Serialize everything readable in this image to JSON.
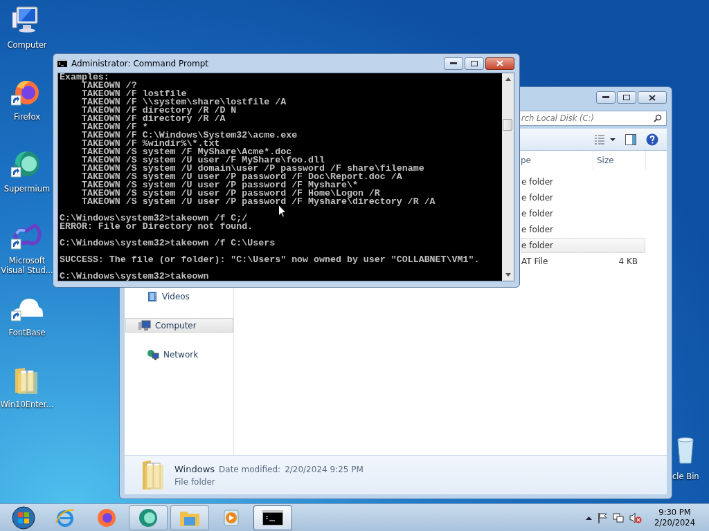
{
  "desktop_icons": [
    {
      "label": "Computer",
      "kind": "computer",
      "shortcut": false
    },
    {
      "label": "Firefox",
      "kind": "firefox",
      "shortcut": true
    },
    {
      "label": "Supermium",
      "kind": "supermium",
      "shortcut": true
    },
    {
      "label": "Microsoft Visual Stud...",
      "kind": "vs",
      "shortcut": true
    },
    {
      "label": "FontBase",
      "kind": "fontbase",
      "shortcut": true
    },
    {
      "label": "Win10Enter...",
      "kind": "folder",
      "shortcut": false
    }
  ],
  "recycle_bin": {
    "label": "cle Bin"
  },
  "explorer": {
    "search": {
      "placeholder": "rch Local Disk (C:)"
    },
    "columns": [
      "pe",
      "Size"
    ],
    "rows": [
      {
        "type": "e folder",
        "selected": false
      },
      {
        "type": "e folder",
        "selected": false
      },
      {
        "type": "e folder",
        "selected": false
      },
      {
        "type": "e folder",
        "selected": false
      },
      {
        "type": "e folder",
        "selected": true
      },
      {
        "type": "AT File",
        "size": "4 KB",
        "selected": false
      }
    ],
    "nav_items": [
      {
        "label": "Videos",
        "kind": "videos",
        "selected": false
      },
      {
        "label": "Computer",
        "kind": "computer",
        "selected": true
      },
      {
        "label": "Network",
        "kind": "network",
        "selected": false
      }
    ],
    "details": {
      "name": "Windows",
      "date_label": "Date modified:",
      "date": "2/20/2024 9:25 PM",
      "type": "File folder"
    }
  },
  "cmd": {
    "title": "Administrator: Command Prompt",
    "blocks": [
      [
        "Examples:",
        "    TAKEOWN /?",
        "    TAKEOWN /F lostfile",
        "    TAKEOWN /F \\\\system\\share\\lostfile /A",
        "    TAKEOWN /F directory /R /D N",
        "    TAKEOWN /F directory /R /A",
        "    TAKEOWN /F *",
        "    TAKEOWN /F C:\\Windows\\System32\\acme.exe",
        "    TAKEOWN /F %windir%\\*.txt",
        "    TAKEOWN /S system /F MyShare\\Acme*.doc",
        "    TAKEOWN /S system /U user /F MyShare\\foo.dll",
        "    TAKEOWN /S system /U domain\\user /P password /F share\\filename",
        "    TAKEOWN /S system /U user /P password /F Doc\\Report.doc /A",
        "    TAKEOWN /S system /U user /P password /F Myshare\\*",
        "    TAKEOWN /S system /U user /P password /F Home\\Logon /R",
        "    TAKEOWN /S system /U user /P password /F Myshare\\directory /R /A"
      ],
      [
        "C:\\Windows\\system32>takeown /f C;/",
        "ERROR: File or Directory not found."
      ],
      [
        "C:\\Windows\\system32>takeown /f C:\\Users"
      ],
      [
        "SUCCESS: The file (or folder): \"C:\\Users\" now owned by user \"COLLABNET\\VM1\"."
      ],
      [
        "C:\\Windows\\system32>takeown"
      ]
    ]
  },
  "taskbar": {
    "buttons": [
      {
        "kind": "start",
        "running": false,
        "selected": false
      },
      {
        "kind": "ie",
        "running": false,
        "selected": false
      },
      {
        "kind": "firefox",
        "running": false,
        "selected": false
      },
      {
        "kind": "supermium",
        "running": true,
        "selected": false
      },
      {
        "kind": "explorer",
        "running": true,
        "selected": false
      },
      {
        "kind": "media",
        "running": false,
        "selected": false
      },
      {
        "kind": "cmd",
        "running": true,
        "selected": true
      }
    ],
    "tray": {
      "time": "9:30 PM",
      "date": "2/20/2024"
    }
  }
}
